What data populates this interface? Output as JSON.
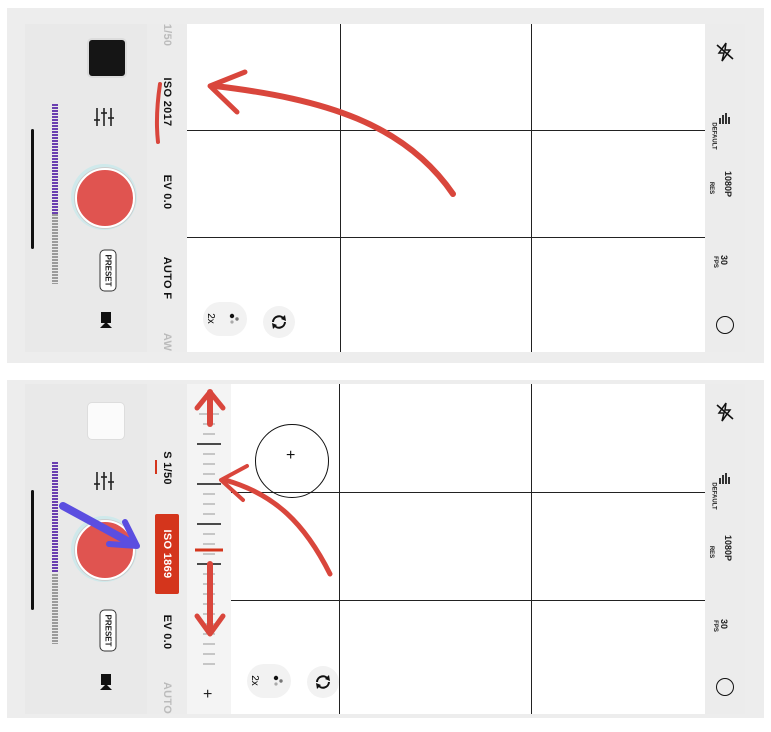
{
  "top": {
    "info": {
      "iso": "ISO 2017",
      "ev": "EV 0.0",
      "focus": "AUTO F",
      "shutter_clipped": "1/50",
      "bottom_clipped": "AW"
    },
    "right": {
      "fps_value": "30",
      "fps_unit": "FPS",
      "res_value": "1080P",
      "res_unit": "RES",
      "default_label": "DEFAULT"
    },
    "side": {
      "preset": "PRESET"
    },
    "zoom": "2x"
  },
  "bottom": {
    "info": {
      "shutter": "S 1/50",
      "iso": "ISO 1869",
      "ev": "EV 0.0",
      "bottom_clipped": "AUTO"
    },
    "right": {
      "fps_value": "30",
      "fps_unit": "FPS",
      "res_value": "1080P",
      "res_unit": "RES",
      "default_label": "DEFAULT"
    },
    "side": {
      "preset": "PRESET"
    },
    "zoom": "2x",
    "dial": {
      "minus": "−",
      "plus": "+"
    }
  },
  "colors": {
    "accent_red": "#d4351c",
    "annotation_red": "#d9463c",
    "annotation_purple": "#5b4ee0",
    "record": "#e05450",
    "meter": "#6a3fb0"
  },
  "icons": [
    "flash-off-icon",
    "histogram-icon",
    "record-circle-icon",
    "sliders-icon",
    "preset-icon",
    "tripod-icon",
    "camera-flip-icon",
    "zoom-dots-icon",
    "focus-reticle-icon"
  ]
}
